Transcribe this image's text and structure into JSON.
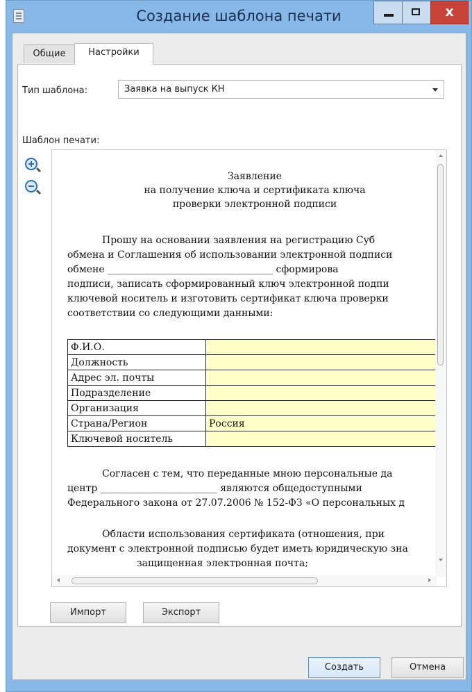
{
  "window": {
    "title": "Создание шаблона печати",
    "close_glyph": "x"
  },
  "tabs": [
    {
      "label": "Общие"
    },
    {
      "label": "Настройки"
    }
  ],
  "template_type": {
    "label": "Тип шаблона:",
    "value": "Заявка на выпуск КН"
  },
  "print_template": {
    "label": "Шаблон печати:"
  },
  "document": {
    "heading": [
      "Заявление",
      "на получение ключа и сертификата ключа",
      "проверки электронной подписи"
    ],
    "paragraph1": [
      "Прошу на основании заявления на регистрацию Суб",
      "обмена и Соглашения об использовании электронной подписи",
      "обмене __________________________________ сформирова",
      "подписи, записать сформированный ключ электронной подпи",
      "ключевой носитель и изготовить сертификат ключа проверки",
      "соответствии со следующими данными:"
    ],
    "table": [
      {
        "key": "Ф.И.О.",
        "value": ""
      },
      {
        "key": "Должность",
        "value": ""
      },
      {
        "key": "Адрес эл. почты",
        "value": ""
      },
      {
        "key": "Подразделение",
        "value": ""
      },
      {
        "key": "Организация",
        "value": ""
      },
      {
        "key": "Страна/Регион",
        "value": "Россия"
      },
      {
        "key": "Ключевой носитель",
        "value": ""
      }
    ],
    "paragraph2": [
      "Согласен с тем, что переданные мною персональные да",
      "центр ________________________ являются общедоступными",
      "Федерального закона от 27.07.2006 № 152-ФЗ «О персональных д"
    ],
    "paragraph3": [
      "Области использования сертификата (отношения, при",
      "документ с электронной подписью будет иметь юридическую зна",
      "защищенная электронная почта;"
    ]
  },
  "buttons": {
    "import": "Импорт",
    "export": "Экспорт",
    "create": "Создать",
    "cancel": "Отмена"
  }
}
